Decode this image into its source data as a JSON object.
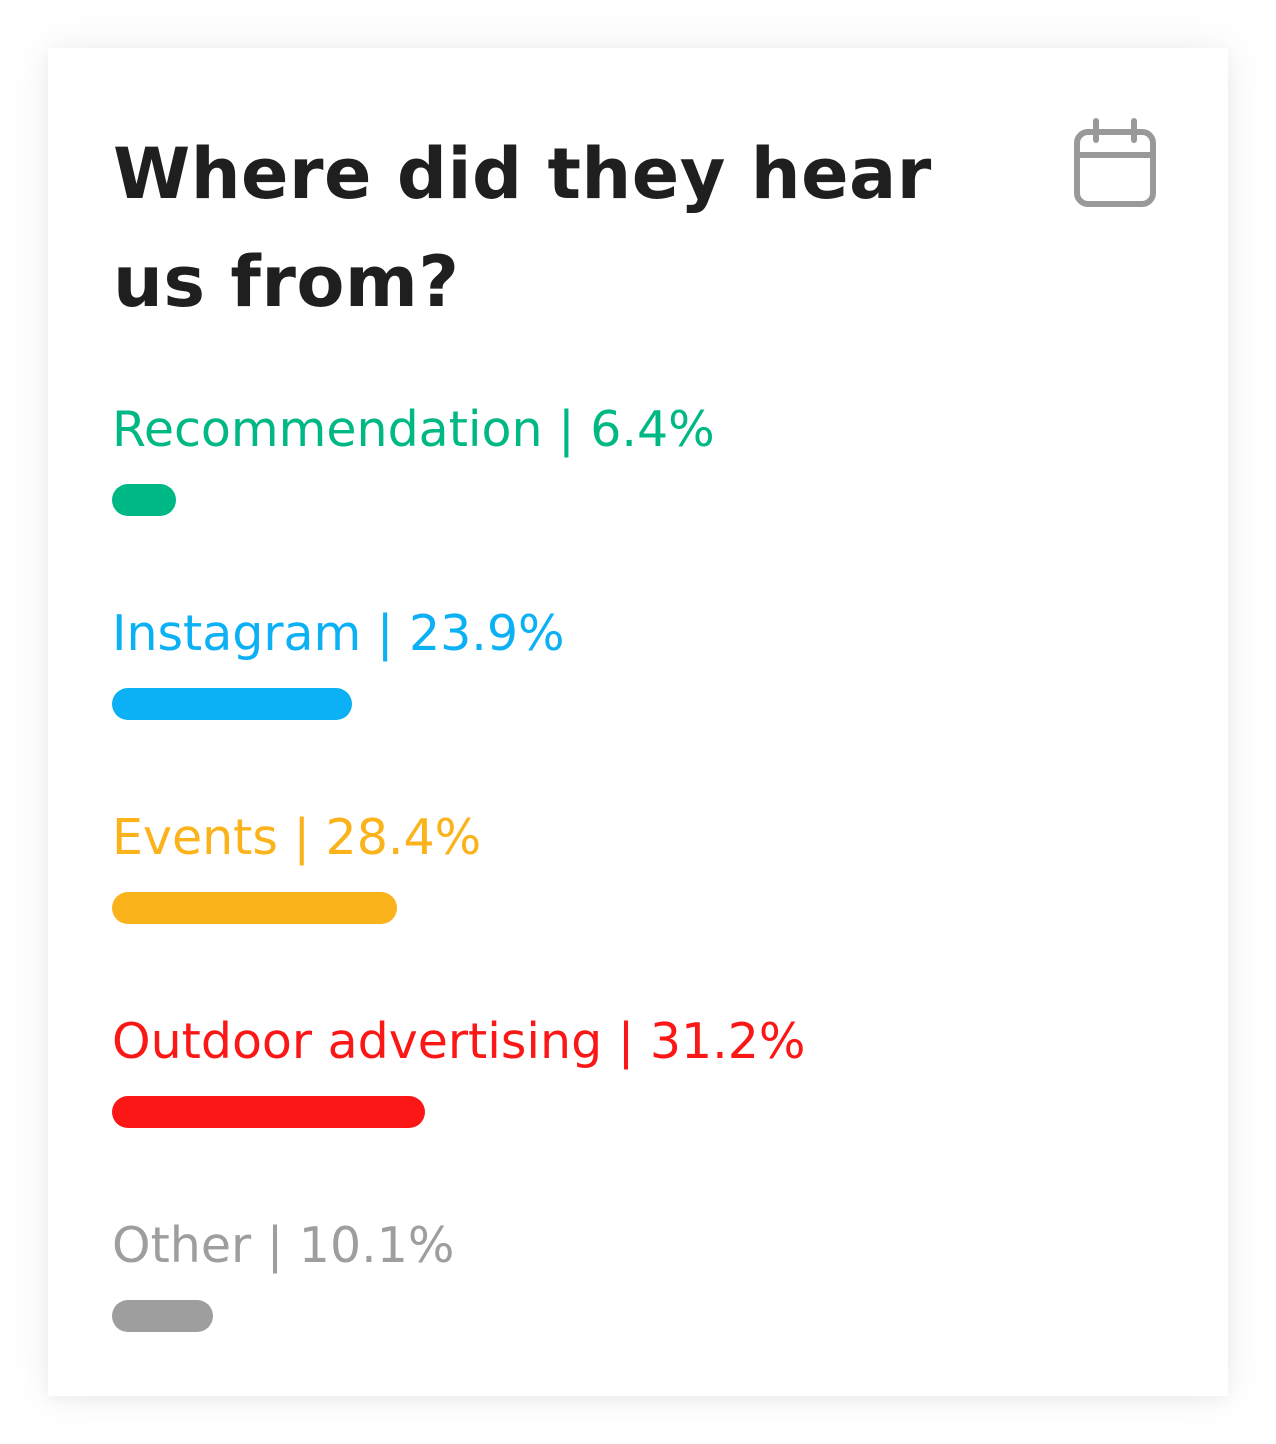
{
  "card": {
    "title": "Where did they hear us from?",
    "calendar_icon": "calendar-icon"
  },
  "chart_data": {
    "type": "bar",
    "orientation": "horizontal",
    "title": "Where did they hear us from?",
    "xlabel": "",
    "ylabel": "",
    "xlim": [
      0,
      100
    ],
    "grid": false,
    "legend": "none",
    "categories": [
      "Recommendation",
      "Instagram",
      "Events",
      "Outdoor advertising",
      "Other"
    ],
    "values": [
      6.4,
      23.9,
      28.4,
      31.2,
      10.1
    ],
    "labels": [
      "Recommendation | 6.4%",
      "Instagram | 23.9%",
      "Events | 28.4%",
      "Outdoor advertising | 31.2%",
      "Other | 10.1%"
    ],
    "colors": [
      "#00b884",
      "#0cb0f5",
      "#fbb31c",
      "#fc1717",
      "#9e9e9e"
    ]
  }
}
